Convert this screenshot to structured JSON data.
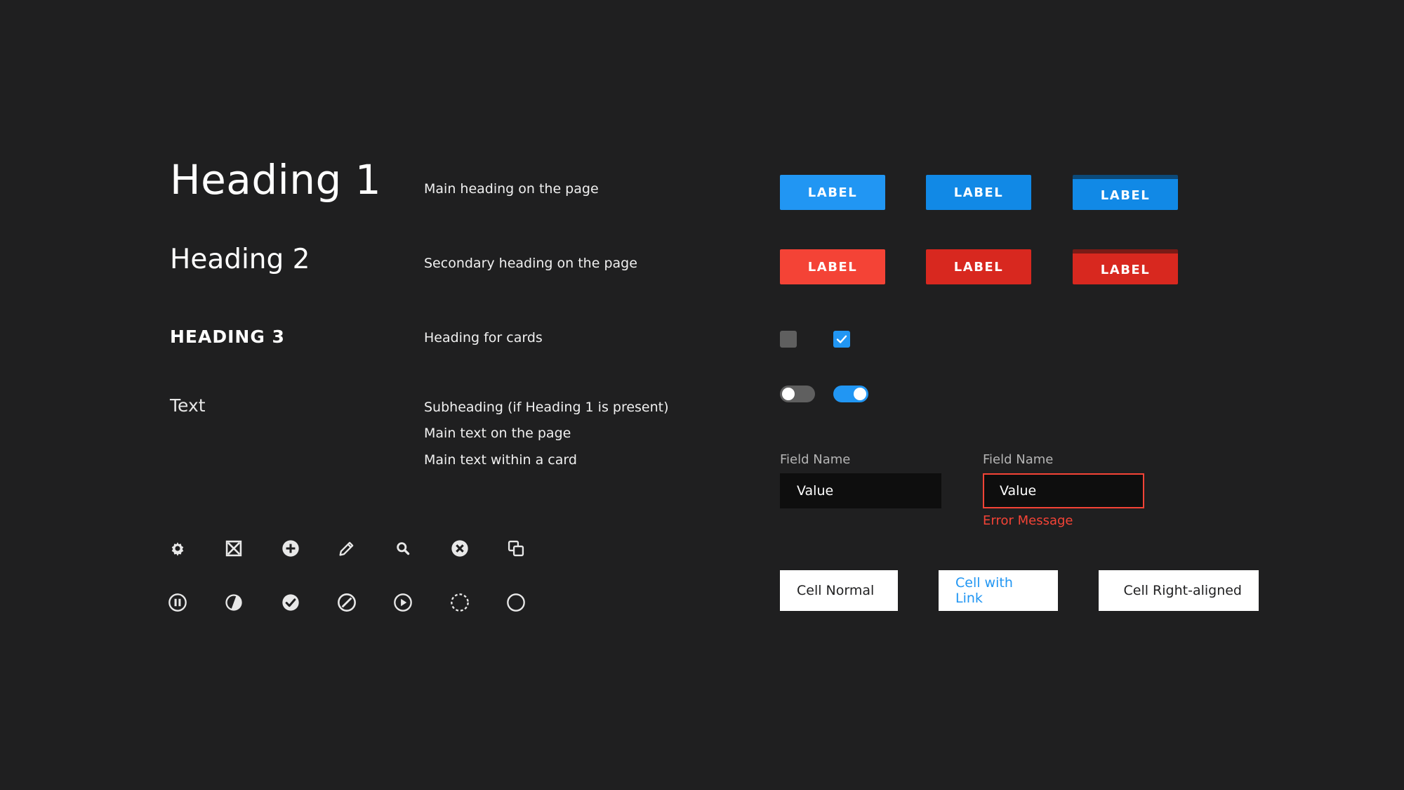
{
  "typography": {
    "h1": {
      "sample": "Heading 1",
      "description": "Main heading on the page"
    },
    "h2": {
      "sample": "Heading 2",
      "description": "Secondary heading on the page"
    },
    "h3": {
      "sample": "HEADING 3",
      "description": "Heading for cards"
    },
    "text": {
      "sample": "Text",
      "descriptions": [
        "Subheading (if Heading 1 is present)",
        "Main text on the page",
        "Main text within a card"
      ]
    }
  },
  "buttons": {
    "primary": [
      "LABEL",
      "LABEL",
      "LABEL"
    ],
    "danger": [
      "LABEL",
      "LABEL",
      "LABEL"
    ]
  },
  "checkboxes": {
    "unchecked": false,
    "checked": true
  },
  "toggles": {
    "off": false,
    "on": true
  },
  "fields": [
    {
      "label": "Field Name",
      "value": "Value"
    },
    {
      "label": "Field Name",
      "value": "Value",
      "error": "Error Message"
    }
  ],
  "cells": {
    "normal": "Cell Normal",
    "link": "Cell with Link",
    "right": "Cell Right-aligned"
  },
  "icons": {
    "row1": [
      "gear-icon",
      "close-box-icon",
      "add-circle-icon",
      "pencil-icon",
      "search-icon",
      "close-circle-icon",
      "copy-icon"
    ],
    "row2": [
      "pause-circle-icon",
      "half-circle-icon",
      "check-circle-icon",
      "block-icon",
      "play-circle-icon",
      "dashed-circle-icon",
      "empty-circle-icon"
    ]
  },
  "colors": {
    "background": "#1f1f20",
    "primary": "#2196f3",
    "danger": "#f44336",
    "neutral": "#5f5f5f"
  }
}
